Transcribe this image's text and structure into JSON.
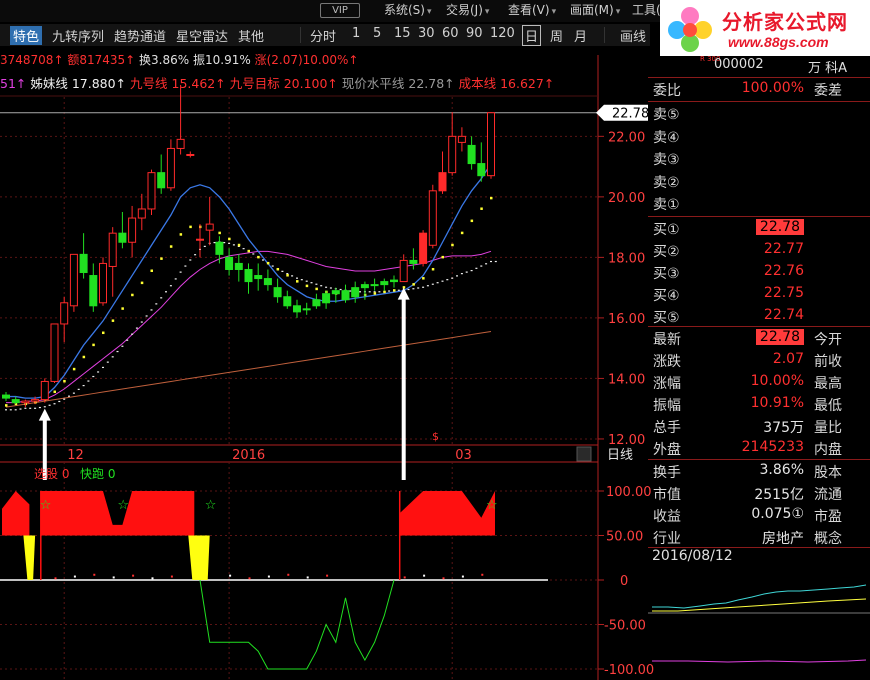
{
  "menu": {
    "vip_badge": "VIP",
    "items": [
      "系统(S)",
      "交易(J)",
      "查看(V)",
      "画面(M)",
      "工具(T)"
    ]
  },
  "toolbar": {
    "special": "特色",
    "items": [
      "九转序列",
      "趋势通道",
      "星空雷达",
      "其他"
    ],
    "period_label": "分时",
    "periods": [
      "1",
      "5",
      "15",
      "30",
      "60",
      "90",
      "120"
    ],
    "period_day": "日",
    "period_week": "周",
    "period_month": "月",
    "draw_label": "画线"
  },
  "brand": {
    "title": "分析家公式网",
    "url": "www.88gs.com"
  },
  "infoline": {
    "volume": "3748708↑",
    "amount": "额817435↑",
    "turnover": "换3.86%",
    "amplitude": "振10.91%",
    "change": "涨(2.07)10.00%↑"
  },
  "maline": {
    "prefix": "51↑",
    "sister": "姊妹线 17.880↑",
    "nine": "九号线 15.462↑",
    "nine_target": "九号目标 20.100↑",
    "price_level": "现价水平线 22.78↑",
    "cost": "成本线 16.627↑"
  },
  "colors": {
    "up": "#ff2a2a",
    "down": "#21e021",
    "ma_blue": "#3a78e6",
    "ma_magenta": "#e040e0",
    "ma_brown": "#c0603c",
    "dots_yellow": "#ffff33",
    "dots_white": "#f0f0f0",
    "grid": "#5a1414"
  },
  "chart_data": [
    {
      "type": "candlestick",
      "period": "日线",
      "x_ticks": [
        "12",
        "2016",
        "03"
      ],
      "y_ticks": [
        22.0,
        20.0,
        18.0,
        16.0,
        14.0,
        12.0
      ],
      "ylim": [
        11.8,
        23.3
      ],
      "current_price_label": "22.78",
      "candles": [
        {
          "o": 13.45,
          "h": 13.55,
          "l": 13.25,
          "c": 13.35
        },
        {
          "o": 13.3,
          "h": 13.4,
          "l": 13.15,
          "c": 13.2
        },
        {
          "o": 13.2,
          "h": 13.3,
          "l": 13.05,
          "c": 13.25
        },
        {
          "o": 13.25,
          "h": 13.4,
          "l": 13.15,
          "c": 13.3
        },
        {
          "o": 13.3,
          "h": 14.0,
          "l": 13.2,
          "c": 13.9
        },
        {
          "o": 13.9,
          "h": 15.8,
          "l": 13.85,
          "c": 15.8
        },
        {
          "o": 15.8,
          "h": 16.7,
          "l": 15.2,
          "c": 16.5
        },
        {
          "o": 16.4,
          "h": 18.1,
          "l": 16.2,
          "c": 18.1
        },
        {
          "o": 18.1,
          "h": 18.8,
          "l": 17.3,
          "c": 17.5
        },
        {
          "o": 17.4,
          "h": 17.8,
          "l": 16.2,
          "c": 16.4
        },
        {
          "o": 16.5,
          "h": 18.0,
          "l": 16.4,
          "c": 17.8
        },
        {
          "o": 17.7,
          "h": 19.0,
          "l": 16.7,
          "c": 18.8
        },
        {
          "o": 18.8,
          "h": 19.5,
          "l": 18.3,
          "c": 18.5
        },
        {
          "o": 18.5,
          "h": 19.7,
          "l": 18.0,
          "c": 19.3
        },
        {
          "o": 19.3,
          "h": 20.1,
          "l": 18.9,
          "c": 19.6
        },
        {
          "o": 19.6,
          "h": 20.9,
          "l": 19.4,
          "c": 20.8
        },
        {
          "o": 20.8,
          "h": 21.4,
          "l": 20.1,
          "c": 20.3
        },
        {
          "o": 20.3,
          "h": 21.9,
          "l": 20.2,
          "c": 21.6
        },
        {
          "o": 21.6,
          "h": 23.7,
          "l": 21.4,
          "c": 21.9
        },
        {
          "o": 21.4,
          "h": 21.5,
          "l": 21.3,
          "c": 21.4
        },
        {
          "o": 18.6,
          "h": 19.1,
          "l": 18.0,
          "c": 18.6
        },
        {
          "o": 18.9,
          "h": 20.0,
          "l": 18.4,
          "c": 19.1
        },
        {
          "o": 18.5,
          "h": 18.7,
          "l": 17.8,
          "c": 18.1
        },
        {
          "o": 18.0,
          "h": 18.3,
          "l": 17.4,
          "c": 17.6
        },
        {
          "o": 17.8,
          "h": 18.1,
          "l": 17.2,
          "c": 17.6
        },
        {
          "o": 17.6,
          "h": 17.8,
          "l": 16.8,
          "c": 17.2
        },
        {
          "o": 17.3,
          "h": 17.8,
          "l": 16.9,
          "c": 17.4
        },
        {
          "o": 17.3,
          "h": 17.6,
          "l": 16.9,
          "c": 17.1
        },
        {
          "o": 17.0,
          "h": 17.3,
          "l": 16.5,
          "c": 16.7
        },
        {
          "o": 16.7,
          "h": 16.9,
          "l": 16.3,
          "c": 16.4
        },
        {
          "o": 16.4,
          "h": 16.6,
          "l": 16.0,
          "c": 16.2
        },
        {
          "o": 16.3,
          "h": 16.5,
          "l": 16.1,
          "c": 16.3
        },
        {
          "o": 16.4,
          "h": 16.8,
          "l": 16.3,
          "c": 16.6
        },
        {
          "o": 16.5,
          "h": 16.9,
          "l": 16.3,
          "c": 16.8
        },
        {
          "o": 16.8,
          "h": 17.0,
          "l": 16.5,
          "c": 16.9
        },
        {
          "o": 16.9,
          "h": 17.1,
          "l": 16.5,
          "c": 16.6
        },
        {
          "o": 16.7,
          "h": 17.2,
          "l": 16.5,
          "c": 17.0
        },
        {
          "o": 17.0,
          "h": 17.2,
          "l": 16.6,
          "c": 17.1
        },
        {
          "o": 17.1,
          "h": 17.3,
          "l": 16.9,
          "c": 17.1
        },
        {
          "o": 17.1,
          "h": 17.3,
          "l": 16.9,
          "c": 17.2
        },
        {
          "o": 17.2,
          "h": 17.4,
          "l": 17.0,
          "c": 17.25
        },
        {
          "o": 17.2,
          "h": 18.1,
          "l": 17.2,
          "c": 17.9
        },
        {
          "o": 17.9,
          "h": 18.3,
          "l": 17.6,
          "c": 17.8
        },
        {
          "o": 17.8,
          "h": 18.9,
          "l": 17.7,
          "c": 18.8
        },
        {
          "o": 18.4,
          "h": 20.4,
          "l": 18.3,
          "c": 20.2
        },
        {
          "o": 20.2,
          "h": 21.5,
          "l": 20.1,
          "c": 20.8
        },
        {
          "o": 20.8,
          "h": 22.8,
          "l": 20.7,
          "c": 22.0
        },
        {
          "o": 21.8,
          "h": 22.3,
          "l": 21.5,
          "c": 22.0
        },
        {
          "o": 21.7,
          "h": 22.0,
          "l": 20.9,
          "c": 21.1
        },
        {
          "o": 21.1,
          "h": 21.8,
          "l": 20.5,
          "c": 20.7
        },
        {
          "o": 20.7,
          "h": 22.8,
          "l": 20.6,
          "c": 22.78
        }
      ],
      "ma_blue": [
        13.4,
        13.4,
        13.35,
        13.35,
        13.4,
        13.7,
        14.1,
        14.6,
        15.1,
        15.5,
        15.9,
        16.4,
        16.9,
        17.4,
        17.9,
        18.4,
        18.9,
        19.4,
        20.0,
        20.3,
        20.4,
        20.3,
        20.0,
        19.6,
        19.1,
        18.6,
        18.2,
        17.8,
        17.4,
        17.1,
        16.9,
        16.7,
        16.6,
        16.55,
        16.55,
        16.6,
        16.65,
        16.7,
        16.75,
        16.8,
        16.85,
        16.9,
        17.1,
        17.4,
        17.9,
        18.5,
        19.1,
        19.7,
        20.2,
        20.6,
        21.1
      ],
      "ma_magenta": [
        13.2,
        13.2,
        13.25,
        13.25,
        13.3,
        13.45,
        13.65,
        13.9,
        14.15,
        14.4,
        14.65,
        14.9,
        15.15,
        15.45,
        15.75,
        16.05,
        16.35,
        16.7,
        17.05,
        17.35,
        17.6,
        17.8,
        17.95,
        18.05,
        18.1,
        18.15,
        18.2,
        18.2,
        18.15,
        18.1,
        18.0,
        17.9,
        17.8,
        17.7,
        17.65,
        17.6,
        17.55,
        17.55,
        17.55,
        17.6,
        17.65,
        17.7,
        17.75,
        17.8,
        17.9,
        18.0,
        18.05,
        18.05,
        18.05,
        18.1,
        18.2
      ],
      "ma_brown": [
        13.05,
        13.1,
        13.15,
        13.2,
        13.25,
        13.3,
        13.35,
        13.4,
        13.45,
        13.5,
        13.55,
        13.6,
        13.65,
        13.7,
        13.75,
        13.8,
        13.85,
        13.9,
        13.95,
        14.0,
        14.05,
        14.1,
        14.15,
        14.2,
        14.25,
        14.3,
        14.35,
        14.4,
        14.45,
        14.5,
        14.55,
        14.6,
        14.65,
        14.7,
        14.75,
        14.8,
        14.85,
        14.9,
        14.95,
        15.0,
        15.05,
        15.1,
        15.15,
        15.2,
        15.25,
        15.3,
        15.35,
        15.4,
        15.45,
        15.5,
        15.55
      ],
      "dots_yellow": [
        13.1,
        13.15,
        13.15,
        13.2,
        13.3,
        13.55,
        13.9,
        14.3,
        14.7,
        15.1,
        15.5,
        15.9,
        16.3,
        16.75,
        17.15,
        17.55,
        17.95,
        18.35,
        18.75,
        19.0,
        19.0,
        18.95,
        18.8,
        18.6,
        18.4,
        18.2,
        18.0,
        17.8,
        17.6,
        17.4,
        17.2,
        17.05,
        16.95,
        16.85,
        16.8,
        16.75,
        16.75,
        16.75,
        16.8,
        16.85,
        16.9,
        17.0,
        17.1,
        17.3,
        17.6,
        18.0,
        18.4,
        18.8,
        19.2,
        19.6,
        19.95
      ],
      "dots_white": [
        12.95,
        12.95,
        13.0,
        13.0,
        13.05,
        13.15,
        13.3,
        13.5,
        13.75,
        14.05,
        14.35,
        14.7,
        15.05,
        15.45,
        15.85,
        16.25,
        16.65,
        17.05,
        17.5,
        17.9,
        18.25,
        18.45,
        18.5,
        18.45,
        18.35,
        18.2,
        18.0,
        17.8,
        17.6,
        17.45,
        17.3,
        17.2,
        17.1,
        17.0,
        16.95,
        16.9,
        16.85,
        16.85,
        16.85,
        16.85,
        16.9,
        16.9,
        16.95,
        17.0,
        17.1,
        17.2,
        17.3,
        17.45,
        17.55,
        17.7,
        17.85
      ],
      "price_line": 22.78,
      "arrows_at": [
        4,
        41
      ]
    },
    {
      "type": "indicator",
      "legend": [
        "选股 0",
        "快跑 0"
      ],
      "y_ticks": [
        100.0,
        50.0,
        0,
        -50.0,
        -100.0
      ],
      "ylim": [
        -110,
        110
      ],
      "red_blocks": [
        [
          0,
          2,
          100
        ],
        [
          4,
          19,
          100
        ],
        [
          41,
          50,
          100
        ]
      ],
      "yellow_blocks": [
        [
          2,
          3,
          50
        ],
        [
          19,
          21,
          50
        ]
      ],
      "green_line": [
        [
          20,
          0
        ],
        [
          21,
          -70
        ],
        [
          22,
          -70
        ],
        [
          23,
          -70
        ],
        [
          24,
          -70
        ],
        [
          25,
          -70
        ],
        [
          26,
          -80
        ],
        [
          27,
          -100
        ],
        [
          28,
          -100
        ],
        [
          29,
          -100
        ],
        [
          30,
          -100
        ],
        [
          31,
          -100
        ],
        [
          32,
          -80
        ],
        [
          33,
          -50
        ],
        [
          34,
          -70
        ],
        [
          35,
          -20
        ],
        [
          36,
          -70
        ],
        [
          37,
          -90
        ],
        [
          38,
          -70
        ],
        [
          39,
          -40
        ],
        [
          40,
          0
        ]
      ]
    }
  ],
  "bottom_panel": {
    "period_label": "日线"
  },
  "quote_panel": {
    "code": "000002",
    "name_short": "万 科A",
    "badge": "R 300",
    "weibi_label": "委比",
    "weibi_value": "100.00%",
    "weicha_label": "委差",
    "sells": [
      {
        "label": "卖⑤"
      },
      {
        "label": "卖④"
      },
      {
        "label": "卖③"
      },
      {
        "label": "卖②"
      },
      {
        "label": "卖①"
      }
    ],
    "buys": [
      {
        "label": "买①",
        "price": "22.78"
      },
      {
        "label": "买②",
        "price": "22.77"
      },
      {
        "label": "买③",
        "price": "22.76"
      },
      {
        "label": "买④",
        "price": "22.75"
      },
      {
        "label": "买⑤",
        "price": "22.74"
      }
    ],
    "stats": [
      {
        "label": "最新",
        "value": "22.78",
        "label2": "今开",
        "hl": true
      },
      {
        "label": "涨跌",
        "value": "2.07",
        "label2": "前收"
      },
      {
        "label": "涨幅",
        "value": "10.00%",
        "label2": "最高"
      },
      {
        "label": "振幅",
        "value": "10.91%",
        "label2": "最低"
      },
      {
        "label": "总手",
        "value": "375万",
        "label2": "量比",
        "white": true
      },
      {
        "label": "外盘",
        "value": "2145233",
        "label2": "内盘"
      }
    ],
    "stats2": [
      {
        "label": "换手",
        "value": "3.86%",
        "label2": "股本"
      },
      {
        "label": "市值",
        "value": "2515亿",
        "label2": "流通"
      },
      {
        "label": "收益",
        "value": "0.075①",
        "label2": "市盈"
      },
      {
        "label": "行业",
        "value": "房地产",
        "label2": "概念"
      }
    ],
    "date": "2016/08/12"
  }
}
